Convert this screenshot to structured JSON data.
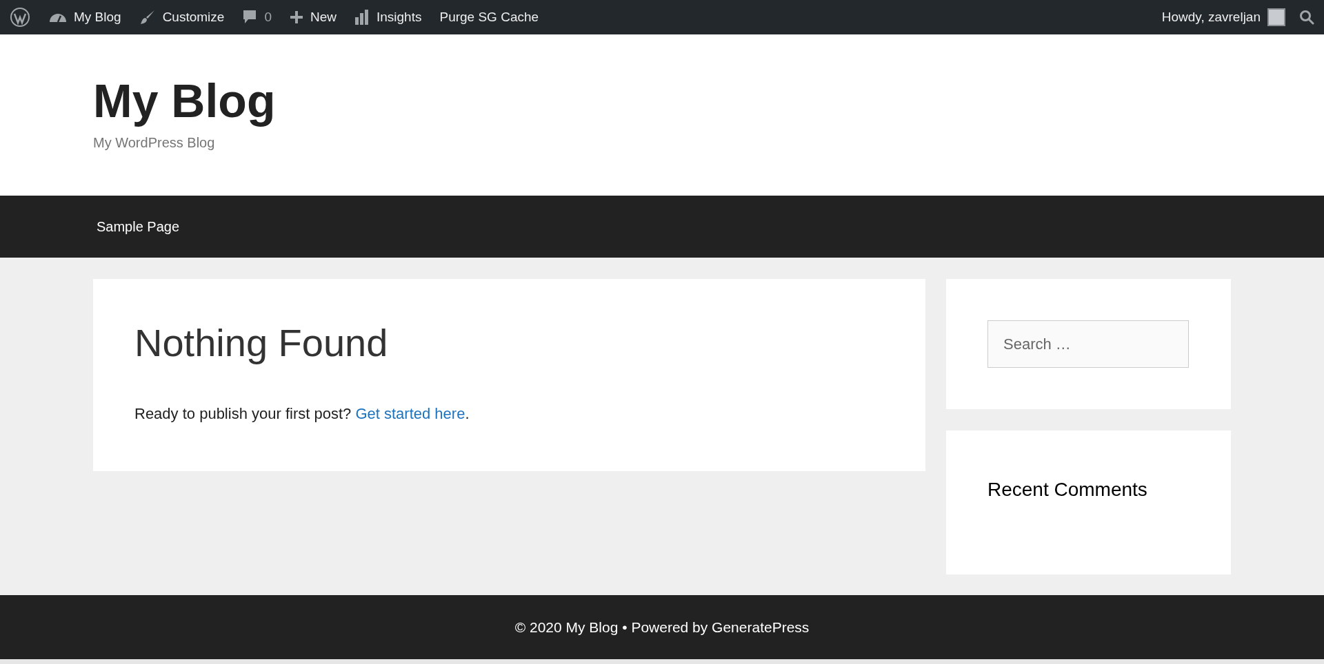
{
  "admin_bar": {
    "items": [
      {
        "kind": "wp-logo"
      },
      {
        "kind": "dashboard",
        "label": "My Blog"
      },
      {
        "kind": "brush",
        "label": "Customize"
      },
      {
        "kind": "comments",
        "label": "0"
      },
      {
        "kind": "plus",
        "label": "New"
      },
      {
        "kind": "chart",
        "label": "Insights"
      },
      {
        "kind": "text",
        "label": "Purge SG Cache"
      }
    ],
    "greeting": "Howdy, zavreljan"
  },
  "header": {
    "title": "My Blog",
    "tagline": "My WordPress Blog"
  },
  "nav": {
    "items": [
      "Sample Page"
    ]
  },
  "main": {
    "heading": "Nothing Found",
    "text": "Ready to publish your first post? ",
    "link": "Get started here",
    "after": "."
  },
  "sidebar": {
    "search": {
      "placeholder": "Search …"
    },
    "widgets": [
      {
        "title": "Recent Comments"
      }
    ]
  },
  "footer": {
    "text": "© 2020 My Blog • Powered by GeneratePress"
  }
}
